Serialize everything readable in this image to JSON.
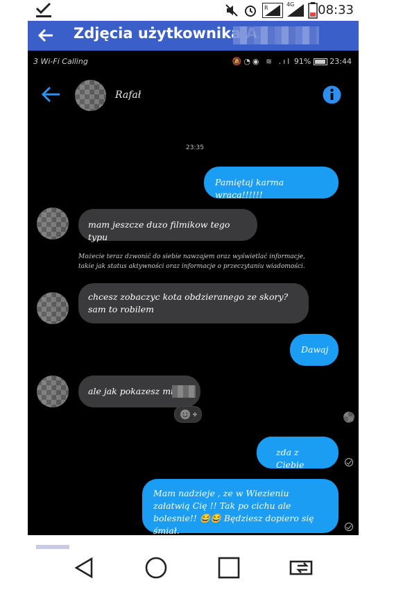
{
  "outer_status": {
    "time": "08:33",
    "network": "4G"
  },
  "appbar": {
    "title": "Zdjęcia użytkownika A"
  },
  "inner_status": {
    "carrier": "3 Wi-Fi Calling",
    "battery": "91%",
    "time": "23:44"
  },
  "chat": {
    "contact_name": "Rafał",
    "timestamp": "23:35",
    "messages": [
      {
        "dir": "out",
        "text": "Pamiętaj karma wraca!!!!!!"
      },
      {
        "dir": "in",
        "text": "mam jeszcze duzo filmikow tego typu"
      },
      {
        "dir": "in",
        "text": "chcesz zobaczyc kota obdzieranego ze skory? sam to robilem"
      },
      {
        "dir": "out",
        "text": "Dawaj"
      },
      {
        "dir": "in",
        "text": "ale jak pokazesz mi c"
      },
      {
        "dir": "out",
        "text": "zda z Ciebie"
      },
      {
        "dir": "out",
        "text": "Mam nadzieje , ze w Wiezieniu załatwią Cię !! Tak po cichu ale bolesnie!! 😂😂 Będziesz dopiero się śmiał."
      }
    ],
    "notice": "Możecie teraz dzwonić do siebie nawzajem oraz wyświetlać informacje, takie jak status aktywności oraz informacje o przeczytaniu wiadomości."
  },
  "icons": {
    "outer_check": "check-icon",
    "back": "arrow-left-icon",
    "info": "info-icon",
    "nav": [
      "back-triangle-icon",
      "home-circle-icon",
      "recents-square-icon",
      "rotate-screen-icon"
    ]
  },
  "colors": {
    "appbar": "#3a5fc8",
    "outgoing": "#1a9df2",
    "incoming": "#3a3a3c",
    "accent": "#2d8ff0"
  }
}
